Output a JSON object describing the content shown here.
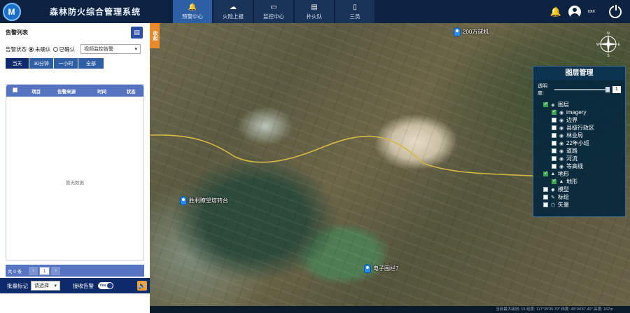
{
  "app": {
    "title": "森林防火综合管理系统"
  },
  "nav": {
    "tabs": [
      {
        "label": "预警中心",
        "icon": "bell-icon"
      },
      {
        "label": "火险上报",
        "icon": "cloud-upload-icon"
      },
      {
        "label": "监控中心",
        "icon": "monitor-icon"
      },
      {
        "label": "扑火队",
        "icon": "desktop-icon"
      },
      {
        "label": "三员",
        "icon": "document-icon"
      }
    ]
  },
  "user": {
    "name": "xxx"
  },
  "alarm": {
    "title": "告警列表",
    "status_label": "告警状态",
    "unconfirmed": "未确认",
    "confirmed": "已确认",
    "type_select": "视频监控告警",
    "time_buttons": [
      "当天",
      "30分钟",
      "一小时",
      "全部"
    ],
    "columns": [
      "项目",
      "告警来源",
      "时间",
      "状态"
    ],
    "empty": "暂无数据",
    "total": "共 0 条",
    "page": "1",
    "prev": "‹",
    "next": "›",
    "batch_label": "批量标记",
    "batch_select": "请选择",
    "receive_label": "接收告警",
    "toggle": "Yes"
  },
  "map": {
    "collapse": "收起",
    "markers": [
      {
        "label": "200万球机"
      },
      {
        "label": "胜利瞭望塔转台"
      },
      {
        "label": "电子围栏7"
      }
    ],
    "compass": {
      "n": "N",
      "s": "S",
      "e": "E",
      "w": "W"
    },
    "statusbar": "当前最大级别: 15    经度: 117°39'35.79\"  纬度: 45°04'47.49\"  高度: 167m"
  },
  "layers": {
    "title": "图层管理",
    "opacity_label": "透明度:",
    "opacity_value": "1",
    "items": [
      {
        "label": "图层",
        "level": 0,
        "checked": true,
        "icon": "layers-icon"
      },
      {
        "label": "imagery",
        "level": 1,
        "checked": true,
        "icon": "globe-icon"
      },
      {
        "label": "边界",
        "level": 1,
        "checked": false,
        "icon": "globe-icon"
      },
      {
        "label": "县级行政区",
        "level": 1,
        "checked": false,
        "icon": "globe-icon"
      },
      {
        "label": "林业局",
        "level": 1,
        "checked": false,
        "icon": "globe-icon"
      },
      {
        "label": "22年小班",
        "level": 1,
        "checked": false,
        "icon": "globe-icon"
      },
      {
        "label": "道路",
        "level": 1,
        "checked": false,
        "icon": "globe-icon"
      },
      {
        "label": "河流",
        "level": 1,
        "checked": false,
        "icon": "globe-icon"
      },
      {
        "label": "等高线",
        "level": 1,
        "checked": false,
        "icon": "globe-icon"
      },
      {
        "label": "地形",
        "level": 0,
        "checked": true,
        "icon": "terrain-icon"
      },
      {
        "label": "地形",
        "level": 1,
        "checked": true,
        "icon": "terrain-icon"
      },
      {
        "label": "模型",
        "level": 0,
        "checked": false,
        "icon": "cube-icon"
      },
      {
        "label": "标绘",
        "level": 0,
        "checked": false,
        "icon": "pen-icon"
      },
      {
        "label": "矢量",
        "level": 0,
        "checked": false,
        "icon": "vector-icon"
      }
    ]
  }
}
